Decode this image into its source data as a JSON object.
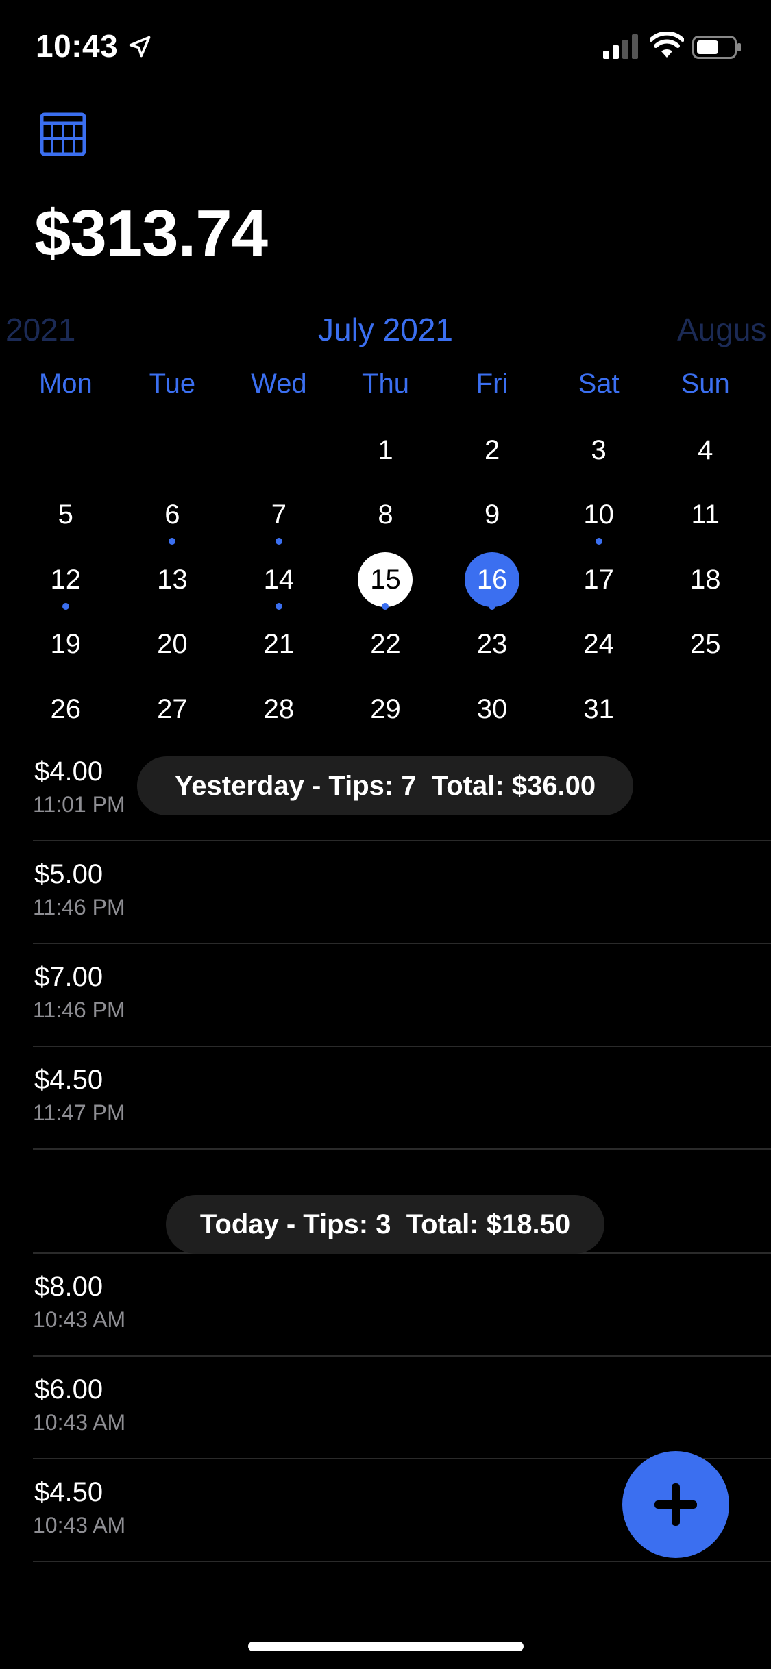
{
  "status_bar": {
    "time": "10:43"
  },
  "header": {
    "total": "$313.74"
  },
  "calendar": {
    "prev_month": "2021",
    "current_month": "July 2021",
    "next_month": "Augus",
    "weekdays": [
      "Mon",
      "Tue",
      "Wed",
      "Thu",
      "Fri",
      "Sat",
      "Sun"
    ],
    "leading_blanks": 3,
    "days": [
      {
        "d": "1",
        "dot": false
      },
      {
        "d": "2",
        "dot": false
      },
      {
        "d": "3",
        "dot": false
      },
      {
        "d": "4",
        "dot": false
      },
      {
        "d": "5",
        "dot": false
      },
      {
        "d": "6",
        "dot": true
      },
      {
        "d": "7",
        "dot": true
      },
      {
        "d": "8",
        "dot": false
      },
      {
        "d": "9",
        "dot": false
      },
      {
        "d": "10",
        "dot": true
      },
      {
        "d": "11",
        "dot": false
      },
      {
        "d": "12",
        "dot": true
      },
      {
        "d": "13",
        "dot": false
      },
      {
        "d": "14",
        "dot": true
      },
      {
        "d": "15",
        "dot": true,
        "state": "today"
      },
      {
        "d": "16",
        "dot": true,
        "state": "selected"
      },
      {
        "d": "17",
        "dot": false
      },
      {
        "d": "18",
        "dot": false
      },
      {
        "d": "19",
        "dot": false
      },
      {
        "d": "20",
        "dot": false
      },
      {
        "d": "21",
        "dot": false
      },
      {
        "d": "22",
        "dot": false
      },
      {
        "d": "23",
        "dot": false
      },
      {
        "d": "24",
        "dot": false
      },
      {
        "d": "25",
        "dot": false
      },
      {
        "d": "26",
        "dot": false
      },
      {
        "d": "27",
        "dot": false
      },
      {
        "d": "28",
        "dot": false
      },
      {
        "d": "29",
        "dot": false
      },
      {
        "d": "30",
        "dot": false
      },
      {
        "d": "31",
        "dot": false
      }
    ]
  },
  "yesterday": {
    "summary": "Yesterday - Tips: 7  Total: $36.00",
    "tips": [
      {
        "amount": "$4.00",
        "time": "11:01 PM"
      },
      {
        "amount": "$5.00",
        "time": "11:46 PM"
      },
      {
        "amount": "$7.00",
        "time": "11:46 PM"
      },
      {
        "amount": "$4.50",
        "time": "11:47 PM"
      }
    ]
  },
  "today": {
    "summary": "Today - Tips: 3  Total: $18.50",
    "tips": [
      {
        "amount": "$8.00",
        "time": "10:43 AM"
      },
      {
        "amount": "$6.00",
        "time": "10:43 AM"
      },
      {
        "amount": "$4.50",
        "time": "10:43 AM"
      }
    ]
  },
  "icons": {
    "calendar": "calendar-grid-icon",
    "add": "plus-icon",
    "location": "location-arrow-icon",
    "signal": "cellular-signal-icon",
    "wifi": "wifi-icon",
    "battery": "battery-icon"
  },
  "colors": {
    "accent": "#3b6ff0",
    "background": "#000000",
    "pill": "#1f1f1f"
  }
}
